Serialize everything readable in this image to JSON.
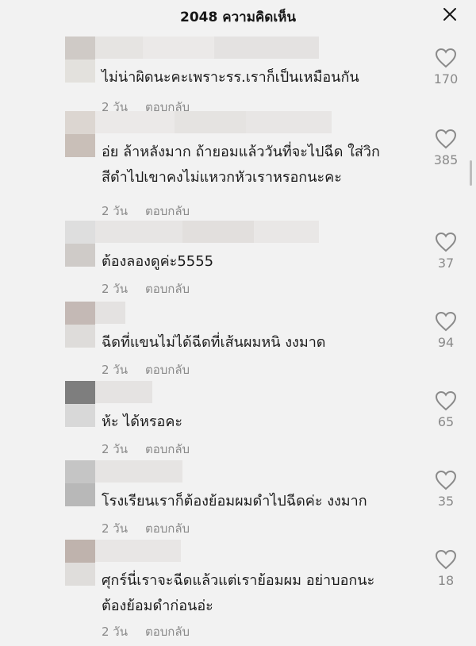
{
  "header": {
    "title": "2048 ความคิดเห็น",
    "close_icon": "close-icon"
  },
  "colors": {
    "background": "#f2f2f2",
    "muted": "#8a8a8a",
    "text": "#161616"
  },
  "comments": [
    {
      "text": "ไม่น่าผิดนะคะเพราะรร.เราก็เป็นเหมือนกัน",
      "time": "2 วัน",
      "reply": "ตอบกลับ",
      "likes": "170"
    },
    {
      "text": "อ่ย ล้าหลังมาก ถ้ายอมแล้ววันที่จะไปฉีด ใส่วิก\nสีดำไปเขาคงไม่แหวกหัวเราหรอกนะคะ",
      "time": "2 วัน",
      "reply": "ตอบกลับ",
      "likes": "385"
    },
    {
      "text": "ต้องลองดูค่ะ5555",
      "time": "2 วัน",
      "reply": "ตอบกลับ",
      "likes": "37"
    },
    {
      "text": "ฉีดที่แขนไม่ได้ฉีดที่เส้นผมหนิ งงมาด",
      "time": "2 วัน",
      "reply": "ตอบกลับ",
      "likes": "94"
    },
    {
      "text": "ห้ะ ได้หรอคะ",
      "time": "2 วัน",
      "reply": "ตอบกลับ",
      "likes": "65"
    },
    {
      "text": "โรงเรียนเราก็ต้องย้อมผมดำไปฉีดค่ะ งงมาก",
      "time": "2 วัน",
      "reply": "ตอบกลับ",
      "likes": "35"
    },
    {
      "text": "ศุกร์นี่เราจะฉีดแล้วแต่เราย้อมผม อย่าบอกนะ\nต้องย้อมดำก่อนอ่ะ",
      "time": "2 วัน",
      "reply": "ตอบกลับ",
      "likes": "18"
    }
  ]
}
